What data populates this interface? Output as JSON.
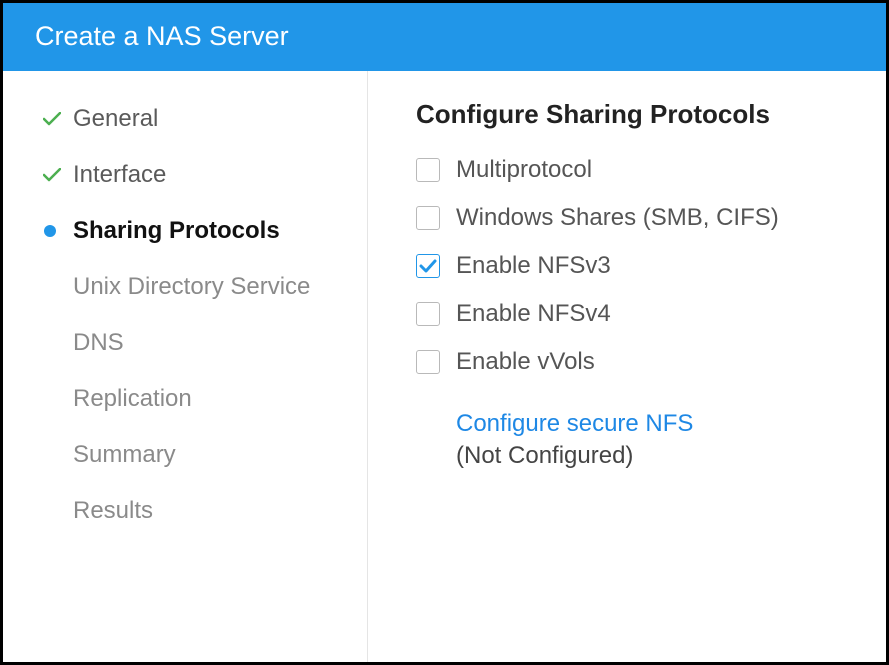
{
  "header": {
    "title": "Create a NAS Server"
  },
  "sidebar": {
    "items": [
      {
        "label": "General",
        "state": "done"
      },
      {
        "label": "Interface",
        "state": "done"
      },
      {
        "label": "Sharing Protocols",
        "state": "current"
      },
      {
        "label": "Unix Directory Service",
        "state": "indent"
      },
      {
        "label": "DNS",
        "state": "indent"
      },
      {
        "label": "Replication",
        "state": "indent"
      },
      {
        "label": "Summary",
        "state": "indent"
      },
      {
        "label": "Results",
        "state": "indent"
      }
    ]
  },
  "main": {
    "heading": "Configure Sharing Protocols",
    "options": [
      {
        "label": "Multiprotocol",
        "checked": false
      },
      {
        "label": "Windows Shares (SMB, CIFS)",
        "checked": false
      },
      {
        "label": "Enable NFSv3",
        "checked": true
      },
      {
        "label": "Enable NFSv4",
        "checked": false
      },
      {
        "label": "Enable vVols",
        "checked": false
      }
    ],
    "secure_nfs": {
      "link": "Configure secure NFS",
      "status": "(Not Configured)"
    }
  }
}
